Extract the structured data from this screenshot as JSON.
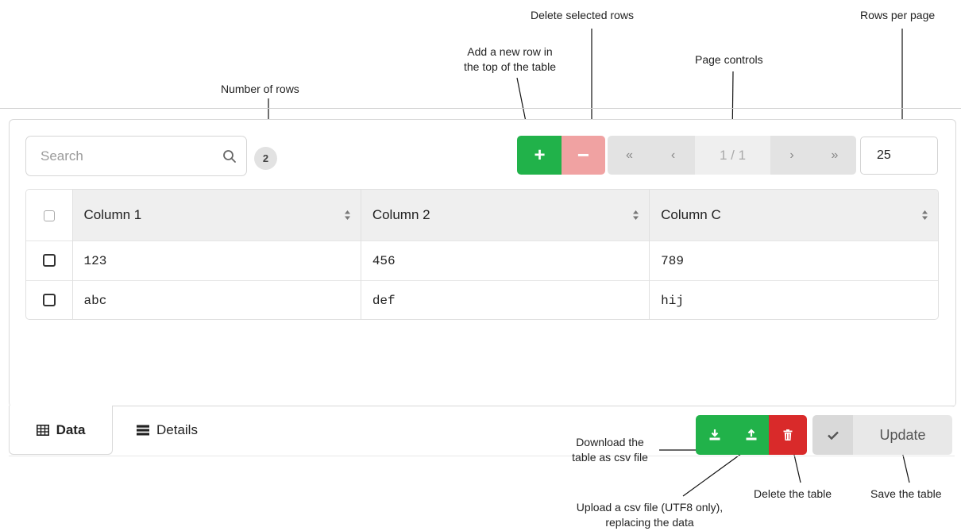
{
  "annotations": {
    "delete_selected": "Delete selected rows",
    "rows_per_page": "Rows per page",
    "add_row_line1": "Add a new row in",
    "add_row_line2": "the top of the table",
    "page_controls": "Page controls",
    "number_of_rows": "Number of rows",
    "download_line1": "Download the",
    "download_line2": "table as csv file",
    "upload_line1": "Upload a csv file (UTF8 only),",
    "upload_line2": "replacing the data",
    "delete_table": "Delete the table",
    "save_table": "Save the table"
  },
  "search": {
    "placeholder": "Search",
    "value": ""
  },
  "row_count": "2",
  "toolbar": {
    "add_label": "+",
    "delete_label": "−"
  },
  "pager": {
    "first": "«",
    "prev": "‹",
    "info": "1 / 1",
    "next": "›",
    "last": "»"
  },
  "rows_per_page": "25",
  "table": {
    "headers": [
      "Column 1",
      "Column 2",
      "Column C"
    ],
    "rows": [
      [
        "123",
        "456",
        "789"
      ],
      [
        "abc",
        "def",
        "hij"
      ]
    ]
  },
  "tabs": [
    {
      "label": "Data",
      "icon": "table-icon",
      "active": true
    },
    {
      "label": "Details",
      "icon": "details-icon",
      "active": false
    }
  ],
  "actions": {
    "update_label": "Update"
  },
  "colors": {
    "green": "#21b24a",
    "pink": "#f0a2a2",
    "red": "#d92a2a",
    "grey": "#e3e3e3"
  }
}
